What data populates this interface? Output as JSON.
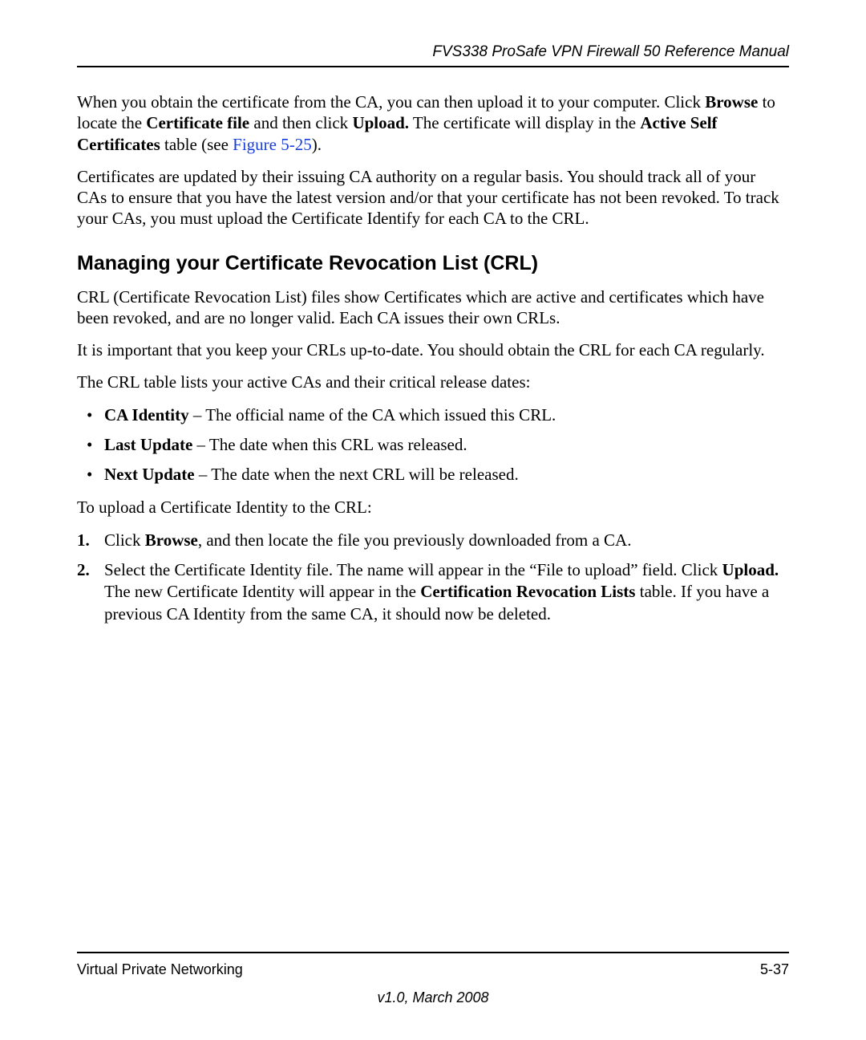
{
  "header": {
    "title": "FVS338 ProSafe VPN Firewall 50 Reference Manual"
  },
  "para1": {
    "t1": "When you obtain the certificate from the CA, you can then upload it to your computer. Click ",
    "b1": "Browse",
    "t2": " to locate the ",
    "b2": "Certificate file",
    "t3": " and then click ",
    "b3": "Upload.",
    "t4": " The certificate will display in the ",
    "b4": "Active Self Certificates",
    "t5": " table (see ",
    "link": "Figure 5-25",
    "t6": ")."
  },
  "para2": "Certificates are updated by their issuing CA authority on a regular basis. You should track all of your CAs to ensure that you have the latest version and/or that your certificate has not been revoked. To track your CAs, you must upload the Certificate Identify for each CA to the CRL.",
  "heading": "Managing your Certificate Revocation List (CRL)",
  "para3": "CRL (Certificate Revocation List) files show Certificates which are active and certificates which have been revoked, and are no longer valid. Each CA issues their own CRLs.",
  "para4": "It is important that you keep your CRLs up-to-date. You should obtain the CRL for each CA regularly.",
  "para5": "The CRL table lists your active CAs and their critical release dates:",
  "bullets": [
    {
      "term": "CA Identity",
      "desc": " – The official name of the CA which issued this CRL."
    },
    {
      "term": "Last Update",
      "desc": " – The date when this CRL was released."
    },
    {
      "term": "Next Update",
      "desc": " – The date when the next CRL will be released."
    }
  ],
  "para6": "To upload a Certificate Identity to the CRL:",
  "steps": {
    "s1": {
      "t1": "Click ",
      "b1": "Browse",
      "t2": ", and then locate the file you previously downloaded from a CA."
    },
    "s2": {
      "t1": "Select the Certificate Identity file. The name will appear in the “File to upload” field. Click ",
      "b1": "Upload.",
      "t2": " The new Certificate Identity will appear in the ",
      "b2": "Certification Revocation Lists",
      "t3": " table. If you have a previous CA Identity from the same CA, it should now be deleted."
    }
  },
  "footer": {
    "section": "Virtual Private Networking",
    "page": "5-37",
    "version": "v1.0, March 2008"
  }
}
